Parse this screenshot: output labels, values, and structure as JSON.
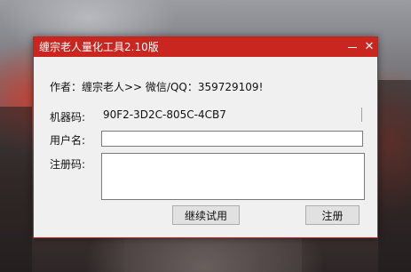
{
  "window": {
    "title": "缠宗老人量化工具2.10版",
    "minimize_glyph": "",
    "close_glyph": "✕"
  },
  "author_line": "作者：缠宗老人>> 微信/QQ：359729109!",
  "form": {
    "machine_code_label": "机器码:",
    "machine_code_value": "90F2-3D2C-805C-4CB7",
    "username_label": "用户名:",
    "username_value": "",
    "reg_code_label": "注册码:",
    "reg_code_value": ""
  },
  "buttons": {
    "trial": "继续试用",
    "register": "注册"
  },
  "colors": {
    "titlebar": "#c9261f",
    "window_bg": "#f0f0f0"
  }
}
